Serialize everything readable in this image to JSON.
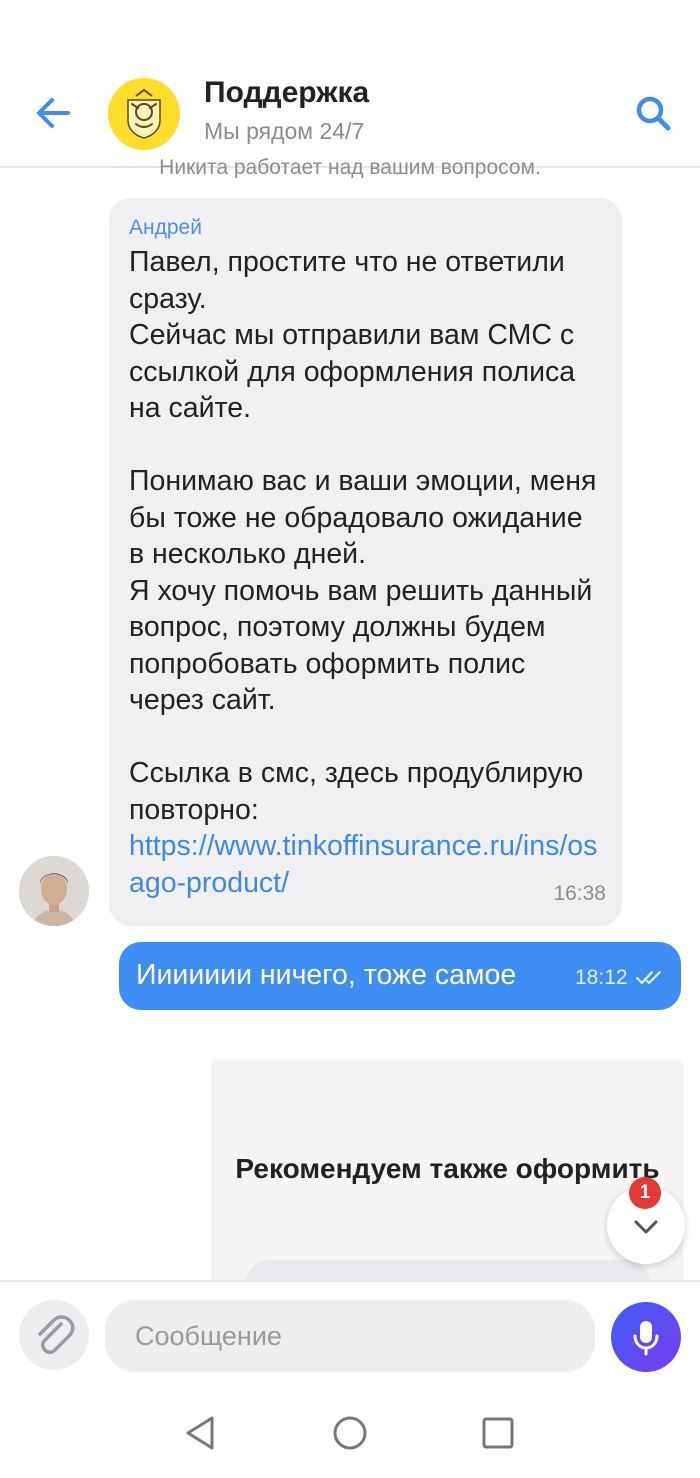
{
  "header": {
    "title": "Поддержка",
    "subtitle": "Мы рядом 24/7"
  },
  "system_note": "Никита работает над вашим вопросом.",
  "messages": {
    "incoming": {
      "author": "Андрей",
      "text": "Павел, простите что не ответили сразу.\nСейчас мы отправили вам СМС с ссылкой для оформления полиса на сайте.\n\nПонимаю вас и ваши эмоции, меня бы тоже не обрадовало ожидание в несколько дней.\nЯ хочу помочь вам решить данный вопрос, поэтому должны будем попробовать оформить полис через сайт.\n\nСсылка в смс, здесь продублирую повторно:",
      "link": "https://www.tinkoffinsurance.ru/ins/osago-product/",
      "time": "16:38"
    },
    "outgoing": {
      "text": "Иииииии ничего, тоже самое",
      "time": "18:12"
    }
  },
  "recommendation": {
    "title": "Рекомендуем также оформить"
  },
  "scroll_down": {
    "badge": "1"
  },
  "composer": {
    "placeholder": "Сообщение"
  },
  "colors": {
    "accent": "#3d8df2",
    "brand_yellow": "#ffdd2d",
    "badge_red": "#e53935"
  },
  "icons": [
    "back-arrow-icon",
    "tinkoff-logo-icon",
    "search-icon",
    "double-check-icon",
    "chevron-down-icon",
    "paperclip-icon",
    "microphone-icon",
    "nav-back-icon",
    "nav-home-icon",
    "nav-recents-icon"
  ]
}
